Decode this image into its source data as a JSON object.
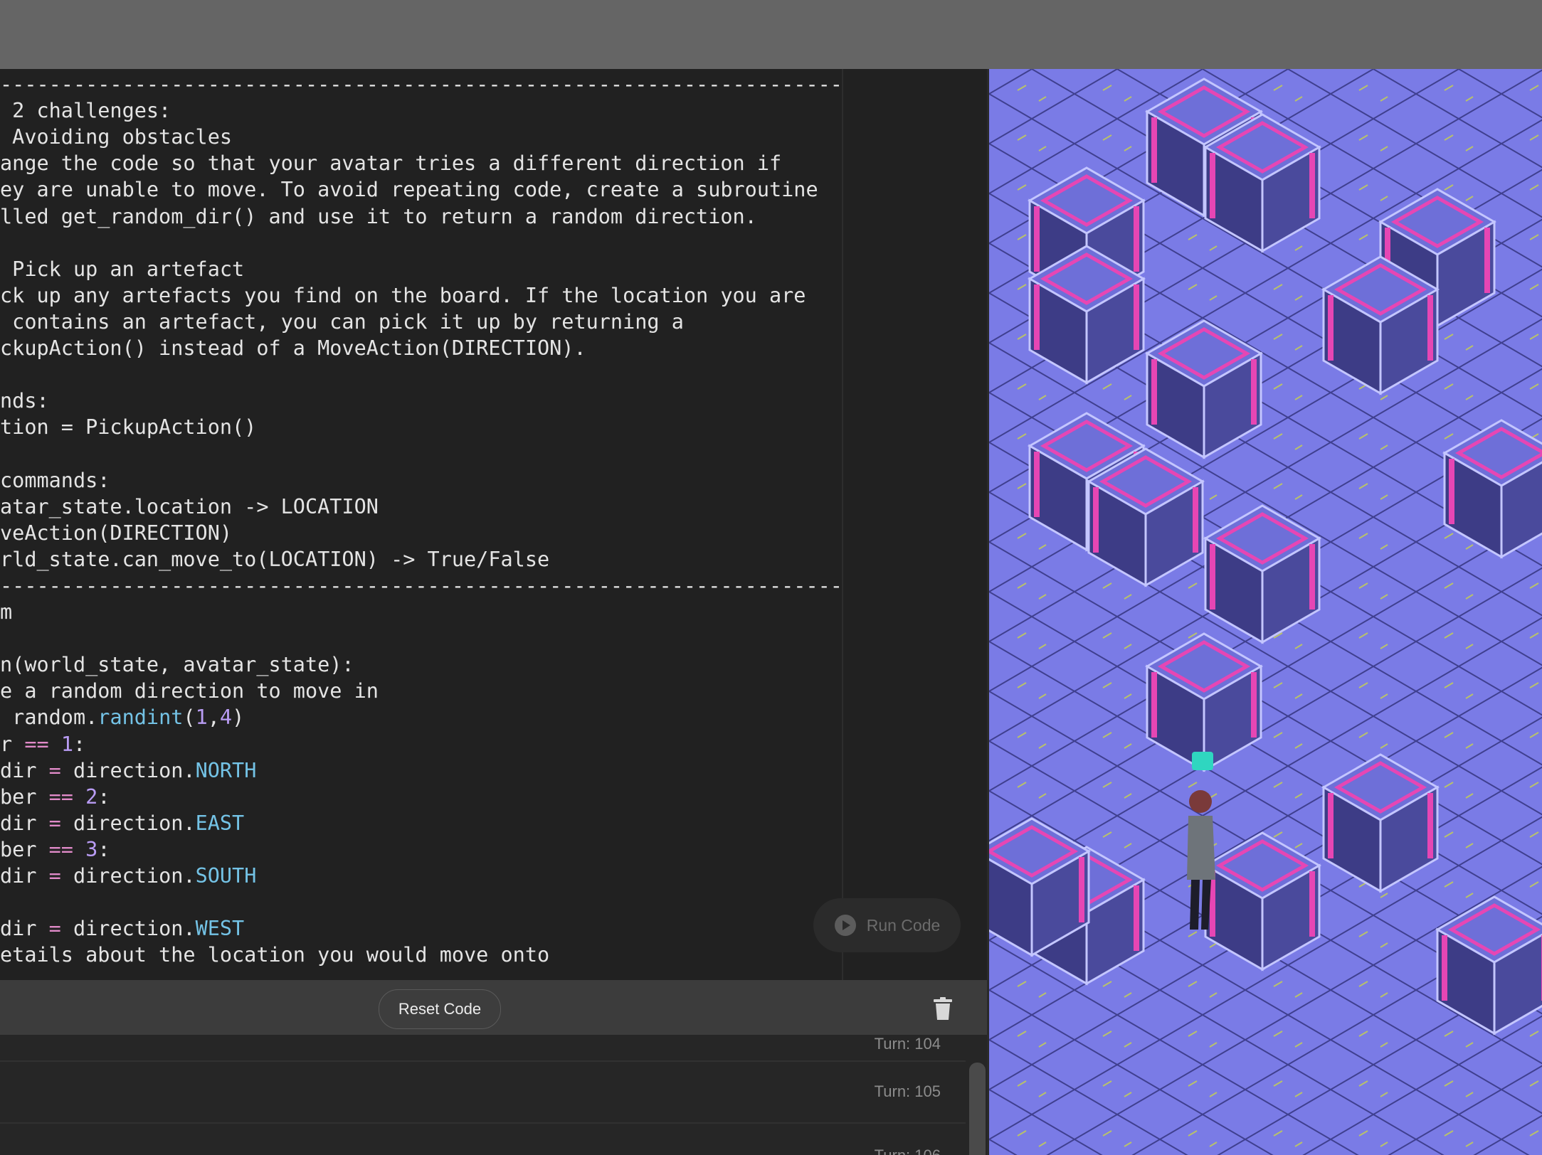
{
  "editor": {
    "lines": [
      [
        {
          "t": "----------------------------------------------------------------------",
          "c": "plain"
        }
      ],
      [
        {
          "t": " 2 challenges:",
          "c": "plain"
        }
      ],
      [
        {
          "t": " Avoiding obstacles",
          "c": "plain"
        }
      ],
      [
        {
          "t": "ange the code so that your avatar tries a different direction if",
          "c": "plain"
        }
      ],
      [
        {
          "t": "ey are unable to move. To avoid repeating code, create a subroutine",
          "c": "plain"
        }
      ],
      [
        {
          "t": "lled get_random_dir() and use it to return a random direction.",
          "c": "plain"
        }
      ],
      [
        {
          "t": "",
          "c": "plain"
        }
      ],
      [
        {
          "t": " Pick up an artefact",
          "c": "plain"
        }
      ],
      [
        {
          "t": "ck up any artefacts you find on the board. If the location you are",
          "c": "plain"
        }
      ],
      [
        {
          "t": " contains an artefact, you can pick it up by returning a",
          "c": "plain"
        }
      ],
      [
        {
          "t": "ckupAction() instead of a MoveAction(DIRECTION).",
          "c": "plain"
        }
      ],
      [
        {
          "t": "",
          "c": "plain"
        }
      ],
      [
        {
          "t": "nds:",
          "c": "plain"
        }
      ],
      [
        {
          "t": "tion = PickupAction()",
          "c": "plain"
        }
      ],
      [
        {
          "t": "",
          "c": "plain"
        }
      ],
      [
        {
          "t": "commands:",
          "c": "plain"
        }
      ],
      [
        {
          "t": "atar_state.location -> LOCATION",
          "c": "plain"
        }
      ],
      [
        {
          "t": "veAction(DIRECTION)",
          "c": "plain"
        }
      ],
      [
        {
          "t": "rld_state.can_move_to(LOCATION) -> True/False",
          "c": "plain"
        }
      ],
      [
        {
          "t": "----------------------------------------------------------------------",
          "c": "plain"
        }
      ],
      [
        {
          "t": "m",
          "c": "plain"
        }
      ],
      [
        {
          "t": "",
          "c": "plain"
        }
      ],
      [
        {
          "t": "n(world_state, avatar_state):",
          "c": "plain"
        }
      ],
      [
        {
          "t": "e a random direction to move in",
          "c": "plain"
        }
      ],
      [
        {
          "t": " random.",
          "c": "plain"
        },
        {
          "t": "randint",
          "c": "fn"
        },
        {
          "t": "(",
          "c": "plain"
        },
        {
          "t": "1",
          "c": "num"
        },
        {
          "t": ",",
          "c": "plain"
        },
        {
          "t": "4",
          "c": "num"
        },
        {
          "t": ")",
          "c": "plain"
        }
      ],
      [
        {
          "t": "r ",
          "c": "plain"
        },
        {
          "t": "==",
          "c": "op"
        },
        {
          "t": " ",
          "c": "plain"
        },
        {
          "t": "1",
          "c": "num"
        },
        {
          "t": ":",
          "c": "plain"
        }
      ],
      [
        {
          "t": "dir ",
          "c": "plain"
        },
        {
          "t": "=",
          "c": "op"
        },
        {
          "t": " direction.",
          "c": "plain"
        },
        {
          "t": "NORTH",
          "c": "const"
        }
      ],
      [
        {
          "t": "ber ",
          "c": "plain"
        },
        {
          "t": "==",
          "c": "op"
        },
        {
          "t": " ",
          "c": "plain"
        },
        {
          "t": "2",
          "c": "num"
        },
        {
          "t": ":",
          "c": "plain"
        }
      ],
      [
        {
          "t": "dir ",
          "c": "plain"
        },
        {
          "t": "=",
          "c": "op"
        },
        {
          "t": " direction.",
          "c": "plain"
        },
        {
          "t": "EAST",
          "c": "const"
        }
      ],
      [
        {
          "t": "ber ",
          "c": "plain"
        },
        {
          "t": "==",
          "c": "op"
        },
        {
          "t": " ",
          "c": "plain"
        },
        {
          "t": "3",
          "c": "num"
        },
        {
          "t": ":",
          "c": "plain"
        }
      ],
      [
        {
          "t": "dir ",
          "c": "plain"
        },
        {
          "t": "=",
          "c": "op"
        },
        {
          "t": " direction.",
          "c": "plain"
        },
        {
          "t": "SOUTH",
          "c": "const"
        }
      ],
      [
        {
          "t": "",
          "c": "plain"
        }
      ],
      [
        {
          "t": "dir ",
          "c": "plain"
        },
        {
          "t": "=",
          "c": "op"
        },
        {
          "t": " direction.",
          "c": "plain"
        },
        {
          "t": "WEST",
          "c": "const"
        }
      ],
      [
        {
          "t": "etails about the location you would move onto",
          "c": "plain"
        }
      ]
    ]
  },
  "run_button": {
    "label": "Run Code",
    "icon": "play-circle-icon"
  },
  "toolbar": {
    "reset_label": "Reset Code",
    "delete_icon": "trash-icon"
  },
  "console": {
    "rows": [
      {
        "turn": "Turn: 104"
      },
      {
        "turn": "Turn: 105"
      },
      {
        "turn": "Turn: 106"
      }
    ]
  },
  "game": {
    "floor_color": "#7a7be6",
    "crate_accent": "#e646b4",
    "artefact_color": "#2fd6c0"
  }
}
